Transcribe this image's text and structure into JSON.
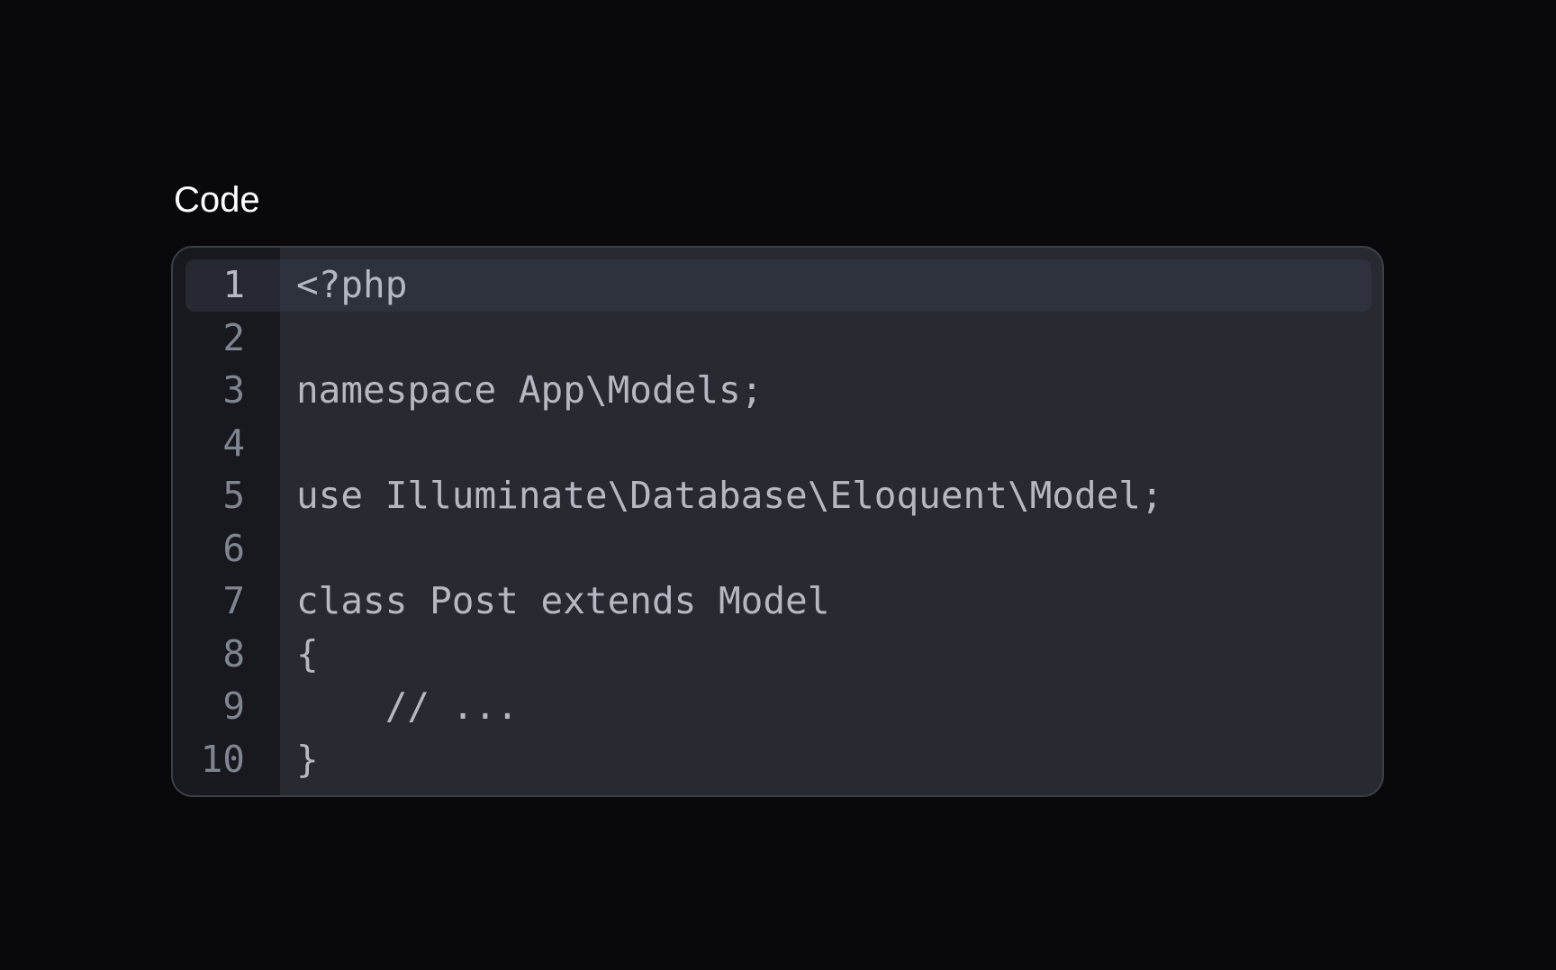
{
  "label": "Code",
  "editor": {
    "active_line": 1,
    "lines": [
      {
        "number": "1",
        "text": "<?php"
      },
      {
        "number": "2",
        "text": ""
      },
      {
        "number": "3",
        "text": "namespace App\\Models;"
      },
      {
        "number": "4",
        "text": ""
      },
      {
        "number": "5",
        "text": "use Illuminate\\Database\\Eloquent\\Model;"
      },
      {
        "number": "6",
        "text": ""
      },
      {
        "number": "7",
        "text": "class Post extends Model"
      },
      {
        "number": "8",
        "text": "{"
      },
      {
        "number": "9",
        "text": "    // ..."
      },
      {
        "number": "10",
        "text": "}"
      }
    ]
  },
  "colors": {
    "page_background": "#09090b",
    "editor_background": "#282a32",
    "gutter_background": "#18191e",
    "active_line_background": "#2d323d",
    "code_text": "#b4b8c0",
    "line_number": "#7f8591"
  }
}
